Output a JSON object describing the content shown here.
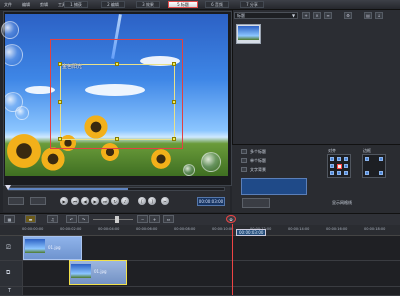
{
  "menu": {
    "items": [
      "文件",
      "编辑",
      "剪辑",
      "工具"
    ]
  },
  "tabs": [
    {
      "label": "1 捕获",
      "active": false
    },
    {
      "label": "2 编辑",
      "active": false
    },
    {
      "label": "3 效果",
      "active": false
    },
    {
      "label": "4 覆叠",
      "active": false
    },
    {
      "label": "5 标题",
      "active": true
    },
    {
      "label": "6 音频",
      "active": false
    },
    {
      "label": "7 分享",
      "active": false
    }
  ],
  "preview": {
    "title_text": "金色阳光"
  },
  "transport": {
    "timecode": "00:00:03:00"
  },
  "library": {
    "dropdown_value": "标题"
  },
  "options": {
    "left_labels": [
      "多个标题",
      "单个标题",
      "文字背景"
    ],
    "right_labels": [
      "对齐",
      "边框"
    ],
    "bottom_label": "显示网格线"
  },
  "timeline": {
    "ruler_ticks": [
      "00:00:00:00",
      "00:00:02:00",
      "00:00:04:00",
      "00:00:06:00",
      "00:00:08:00",
      "00:00:10:00",
      "00:00:12:00",
      "00:00:14:00",
      "00:00:16:00",
      "00:00:18:00"
    ],
    "tooltip": "00:00:03:00",
    "clip1_label": "01.jpg",
    "clip2_label": "01.jpg",
    "track_labels": [
      "",
      "",
      "T"
    ]
  },
  "colors": {
    "accent": "#e24b4b",
    "selected_tab_bg": "#ffffff",
    "timeline_bg": "#1f2024"
  }
}
